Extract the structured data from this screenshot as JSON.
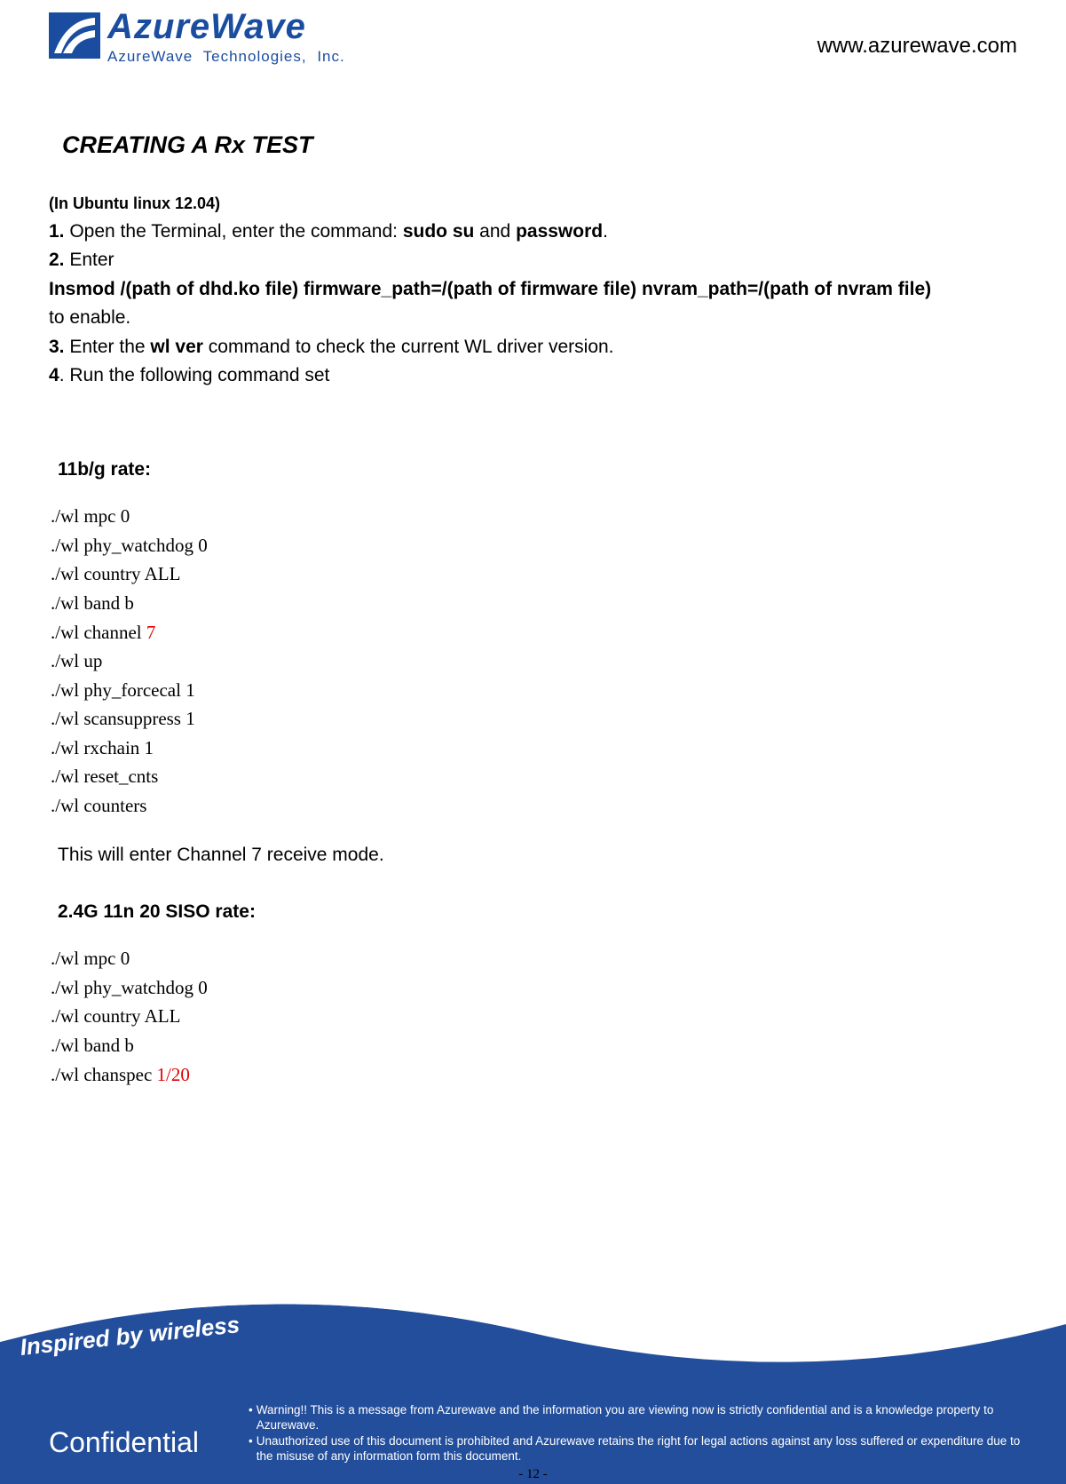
{
  "header": {
    "brand": "AzureWave",
    "company": "AzureWave   Technologies,   Inc.",
    "url": "www.azurewave.com"
  },
  "title": "CREATING A Rx TEST",
  "subtitle": "(In Ubuntu linux 12.04)",
  "steps": {
    "s1": {
      "n": "1.",
      "a": " Open the Terminal, enter the command: ",
      "b": "sudo su",
      "c": " and ",
      "d": "password",
      "e": "."
    },
    "s2": {
      "n": "2.",
      "a": " Enter"
    },
    "insmod": "Insmod /(path of dhd.ko file) firmware_path=/(path of firmware file) nvram_path=/(path of nvram file)",
    "s2_end": "to enable.",
    "s3": {
      "n": "3.",
      "a": " Enter the ",
      "b": "wl ver",
      "c": " command to check the current WL driver version."
    },
    "s4": {
      "n": "4",
      "a": ". Run the following command set"
    }
  },
  "section1": {
    "heading": "11b/g rate:",
    "cmds": [
      "./wl mpc 0",
      "./wl phy_watchdog 0",
      "./wl country ALL",
      "./wl band b"
    ],
    "chan_pre": "./wl channel ",
    "chan_red": "7",
    "cmds2": [
      "./wl up",
      "./wl phy_forcecal 1",
      "./wl scansuppress 1",
      "./wl rxchain 1",
      "./wl reset_cnts",
      "./wl counters"
    ],
    "note": "This will enter Channel 7 receive mode."
  },
  "section2": {
    "heading": "2.4G 11n 20 SISO rate:",
    "cmds": [
      "./wl mpc 0",
      "./wl phy_watchdog 0",
      "./wl country ALL",
      "./wl band b"
    ],
    "chan_pre": "./wl chanspec ",
    "chan_red": "1/20"
  },
  "footer": {
    "tagline": "Inspired by wireless",
    "confidential": "Confidential",
    "d1": "Warning!! This is a message from Azurewave and the information you are viewing now is strictly confidential and is a knowledge property to Azurewave.",
    "d2": "Unauthorized use of this document is prohibited and Azurewave retains the right for legal actions against any loss suffered or expenditure due to the misuse of any information form this document.",
    "page": "- 12 -"
  }
}
